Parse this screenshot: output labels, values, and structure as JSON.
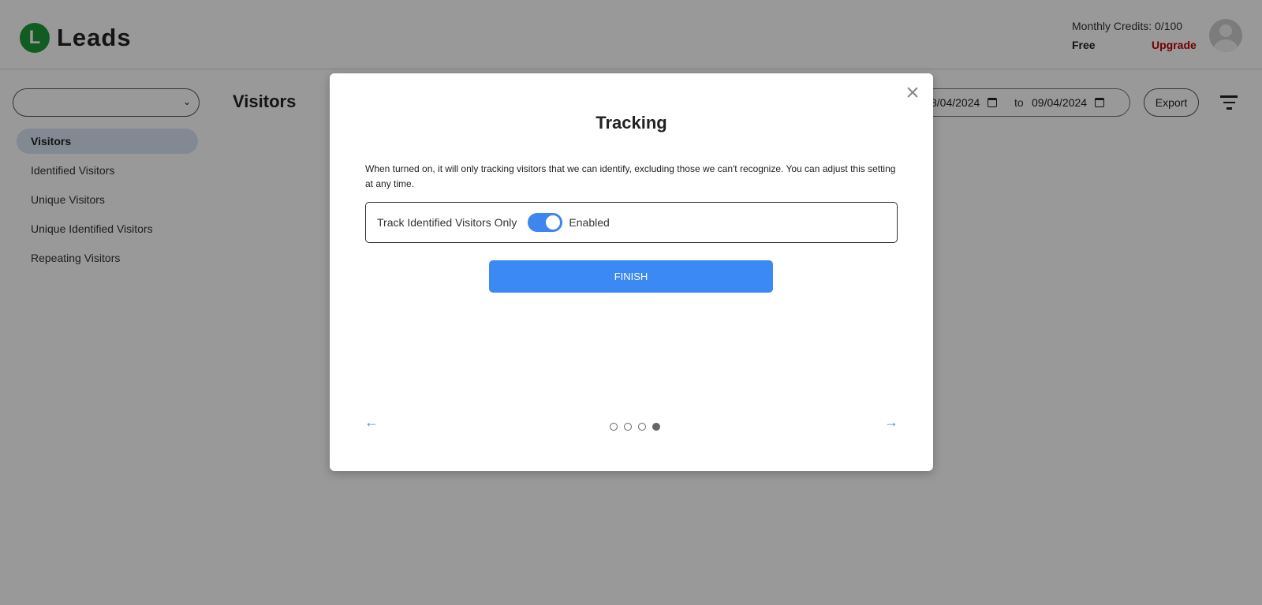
{
  "app": {
    "logo_letter": "L",
    "name": "Leads"
  },
  "account": {
    "credits": "Monthly Credits: 0/100",
    "plan": "Free",
    "upgrade_label": "Upgrade"
  },
  "sidebar": {
    "select_value": "",
    "items": [
      {
        "label": "Visitors",
        "active": true
      },
      {
        "label": "Identified Visitors"
      },
      {
        "label": "Unique Visitors"
      },
      {
        "label": "Unique Identified Visitors"
      },
      {
        "label": "Repeating Visitors"
      }
    ]
  },
  "main": {
    "title": "Visitors",
    "date_from": "8/04/2024",
    "date_separator": "to",
    "date_to": "09/04/2024",
    "export_label": "Export"
  },
  "modal": {
    "title": "Tracking",
    "description": "When turned on, it will only tracking visitors that we can identify, excluding those we can't recognize. You can adjust this setting at any time.",
    "toggle_label": "Track Identified Visitors Only",
    "toggle_state": "Enabled",
    "toggle_on": true,
    "finish_label": "FINISH",
    "close_symbol": "×",
    "prev_symbol": "←",
    "next_symbol": "→",
    "steps_total": 4,
    "current_step": 4
  },
  "colors": {
    "accent": "#3a89f5",
    "logo": "#1f9a3a",
    "upgrade": "#c00000"
  },
  "icons": [
    "logo-icon",
    "avatar-icon",
    "chevron-down-icon",
    "calendar-icon",
    "filter-icon",
    "close-icon",
    "arrow-left-icon",
    "arrow-right-icon"
  ]
}
